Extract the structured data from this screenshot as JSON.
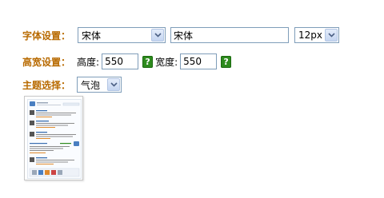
{
  "font_settings": {
    "label": "字体设置：",
    "font_select_value": "宋体",
    "font_input_value": "宋体",
    "size_select_value": "12px"
  },
  "size_settings": {
    "label": "高宽设置：",
    "height_label": "高度:",
    "height_value": "550",
    "width_label": "宽度:",
    "width_value": "550",
    "help_symbol": "?"
  },
  "theme_settings": {
    "label": "主题选择：",
    "theme_select_value": "气泡"
  },
  "preview": {
    "icon": "theme-preview-thumbnail"
  },
  "colors": {
    "label": "#b86a00",
    "help_button": "#2e8b1e",
    "field_border": "#7f9db9"
  }
}
